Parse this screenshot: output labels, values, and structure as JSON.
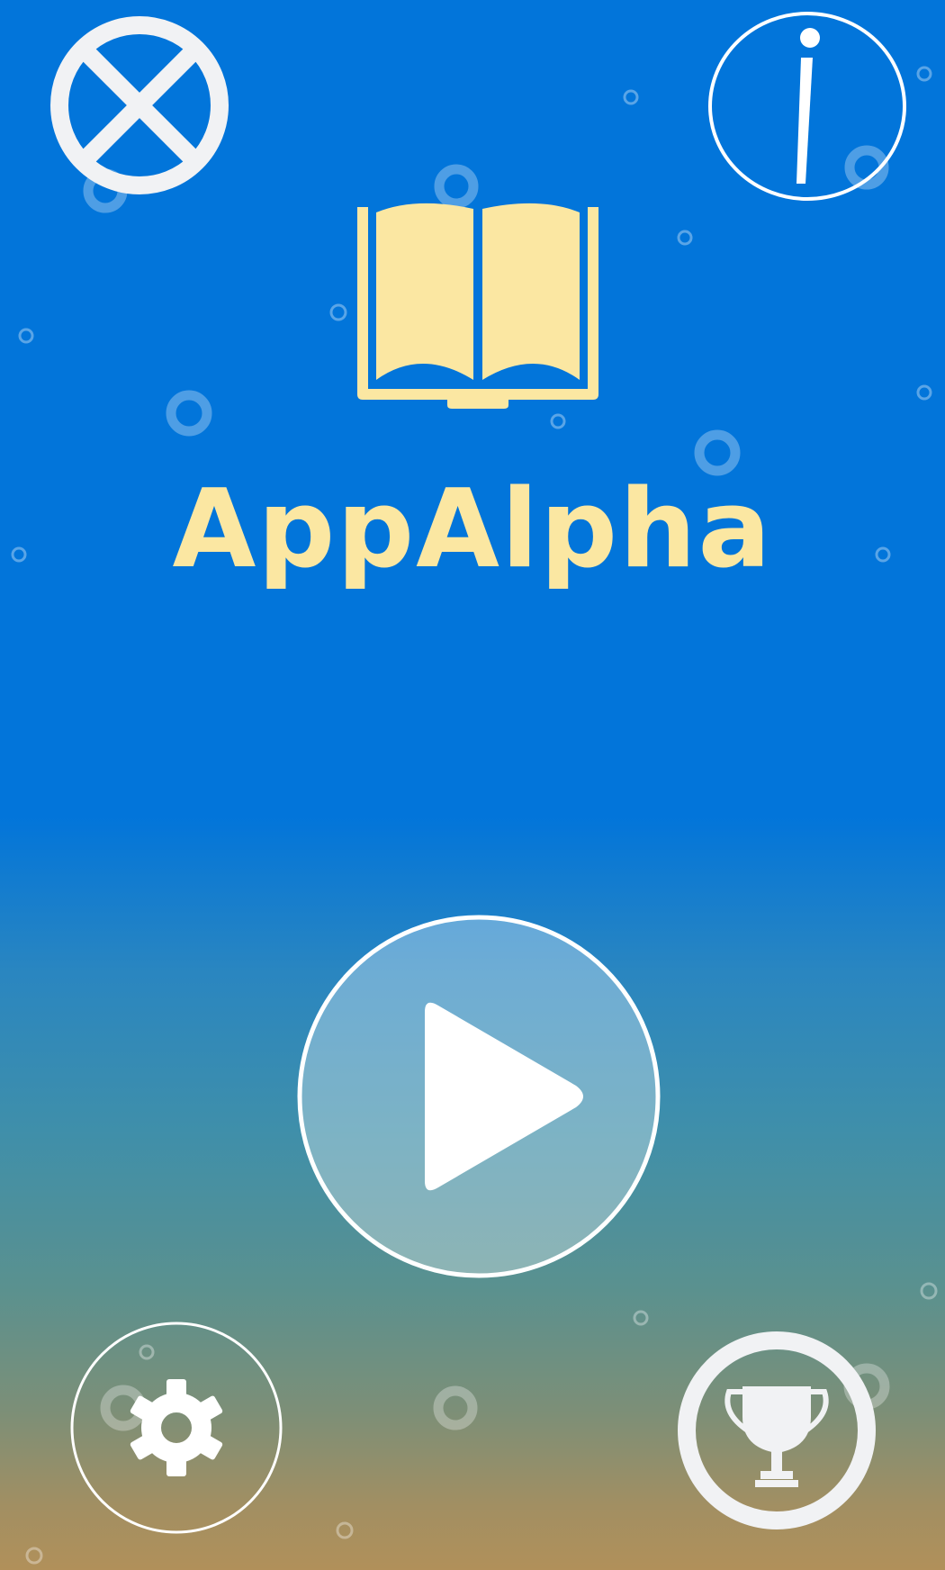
{
  "app": {
    "title": "AppAlpha"
  },
  "icons": {
    "close": "close-icon",
    "info": "info-icon",
    "logo": "open-book-icon",
    "play": "play-icon",
    "settings": "gear-icon",
    "leaderboard": "trophy-icon"
  },
  "colors": {
    "title": "#fbe7a2",
    "book": "#fbe7a2",
    "icon_light": "#f1f2f4",
    "background_top": "#0275da",
    "background_bottom": "#b1905a"
  }
}
